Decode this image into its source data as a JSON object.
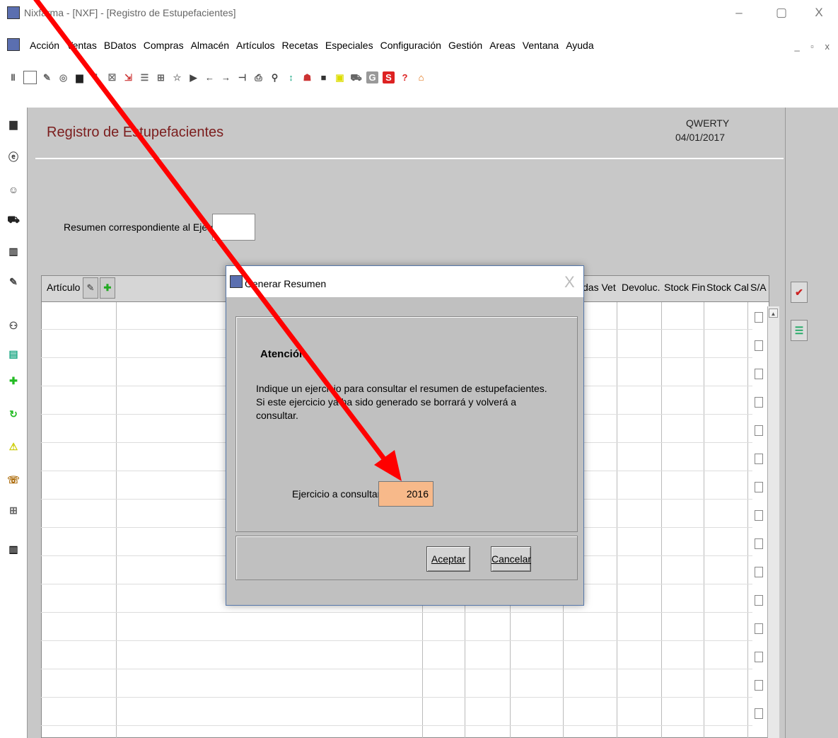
{
  "window": {
    "title": "Nixfarma - [NXF] - [Registro de Estupefacientes]",
    "minimize": "–",
    "restore": "▢",
    "close": "X"
  },
  "menu": {
    "items": [
      "Acción",
      "Ventas",
      "BDatos",
      "Compras",
      "Almacén",
      "Artículos",
      "Recetas",
      "Especiales",
      "Configuración",
      "Gestión",
      "Areas",
      "Ventana",
      "Ayuda"
    ],
    "mdi_controls": "_ ▫ x"
  },
  "toolbar_icons": [
    "pause-icon",
    "document-icon",
    "edit-icon",
    "disc-icon",
    "print-icon",
    "import-icon",
    "list-icon",
    "export-icon",
    "list2-icon",
    "tree-icon",
    "star-icon",
    "next-page-icon",
    "left-arrow-icon",
    "right-arrow-icon",
    "bookmark-icon",
    "print2-icon",
    "search-icon",
    "sort-icon",
    "calc-icon",
    "stop-icon",
    "monitor-icon",
    "cart-icon",
    "G",
    "S",
    "?",
    "home-icon"
  ],
  "form": {
    "title": "Registro de Estupefacientes",
    "user": "QWERTY",
    "date": "04/01/2017",
    "resumen_label": "Resumen correspondiente al Ejercicio",
    "resumen_value": ""
  },
  "grid": {
    "columns": [
      "Artículo",
      "das Vet",
      "Devoluc.",
      "Stock Fin",
      "Stock Cal",
      "S/A"
    ]
  },
  "dialog": {
    "title": "Generar Resumen",
    "close": "X",
    "heading": "Atención",
    "message": "Indique un ejercicio para consultar el resumen de estupefacientes. Si este ejercicio ya ha sido generado se borrará y volverá a consultar.",
    "field_label": "Ejercicio a consultar:",
    "field_value": "2016",
    "accept": "Aceptar",
    "cancel": "Cancelar"
  },
  "colors": {
    "title_red": "#7b1d1d",
    "field_orange": "#f7b98a",
    "arrow_red": "#ff0000",
    "panel_gray": "#c8c8c8"
  }
}
